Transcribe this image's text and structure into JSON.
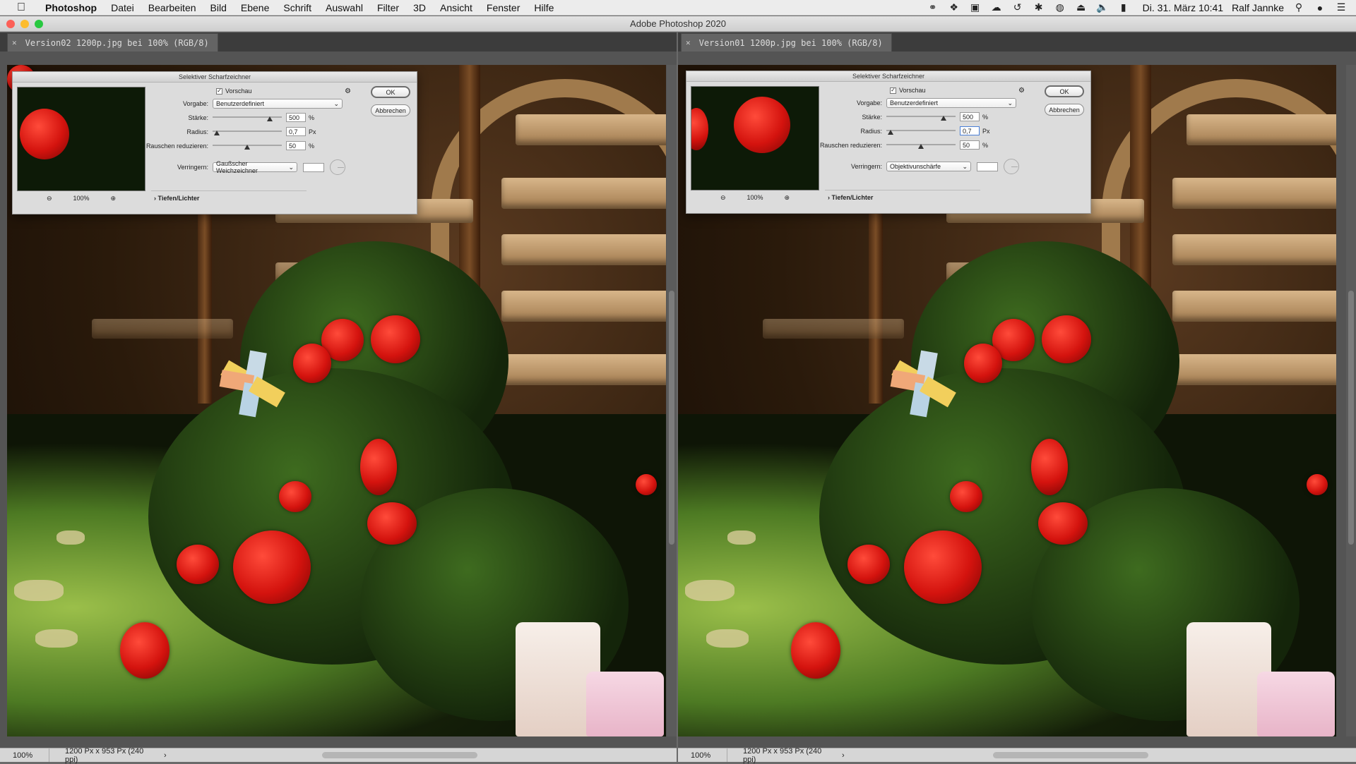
{
  "menubar": {
    "app_name": "Photoshop",
    "menus": [
      "Datei",
      "Bearbeiten",
      "Bild",
      "Ebene",
      "Schrift",
      "Auswahl",
      "Filter",
      "3D",
      "Ansicht",
      "Fenster",
      "Hilfe"
    ],
    "clock": "Di. 31. März  10:41",
    "user": "Ralf Jannke",
    "status_icons": [
      "creative-cloud-icon",
      "dropbox-icon",
      "display-icon",
      "upload-icon",
      "timemachine-icon",
      "bluetooth-icon",
      "wifi-icon",
      "eject-icon",
      "volume-icon",
      "battery-icon"
    ]
  },
  "window": {
    "title": "Adobe Photoshop 2020"
  },
  "documents": [
    {
      "tab_label": "Version02 1200p.jpg bei 100% (RGB/8)",
      "status_zoom": "100%",
      "status_info": "1200 Px x 953 Px (240 ppi)",
      "dialog": {
        "title": "Selektiver Scharfzeichner",
        "preview_label": "Vorschau",
        "preview_checked": true,
        "preset_label": "Vorgabe:",
        "preset_value": "Benutzerdefiniert",
        "amount_label": "Stärke:",
        "amount_value": "500",
        "amount_unit": "%",
        "amount_level": 0.83,
        "radius_label": "Radius:",
        "radius_value": "0,7",
        "radius_unit": "Px",
        "radius_level": 0.06,
        "noise_label": "Rauschen reduzieren:",
        "noise_value": "50",
        "noise_unit": "%",
        "noise_level": 0.5,
        "remove_label": "Verringern:",
        "remove_value": "Gaußscher Weichzeichner",
        "zoom_value": "100%",
        "ok_label": "OK",
        "cancel_label": "Abbrechen",
        "section_label": "Tiefen/Lichter"
      }
    },
    {
      "tab_label": "Version01 1200p.jpg bei 100% (RGB/8)",
      "status_zoom": "100%",
      "status_info": "1200 Px x 953 Px (240 ppi)",
      "dialog": {
        "title": "Selektiver Scharfzeichner",
        "preview_label": "Vorschau",
        "preview_checked": true,
        "preset_label": "Vorgabe:",
        "preset_value": "Benutzerdefiniert",
        "amount_label": "Stärke:",
        "amount_value": "500",
        "amount_unit": "%",
        "amount_level": 0.83,
        "radius_label": "Radius:",
        "radius_value": "0,7",
        "radius_unit": "Px",
        "radius_level": 0.06,
        "noise_label": "Rauschen reduzieren:",
        "noise_value": "50",
        "noise_unit": "%",
        "noise_level": 0.5,
        "remove_label": "Verringern:",
        "remove_value": "Objektivunschärfe",
        "zoom_value": "100%",
        "ok_label": "OK",
        "cancel_label": "Abbrechen",
        "section_label": "Tiefen/Lichter"
      }
    }
  ],
  "colors": {
    "traffic_close": "#fc5f57",
    "traffic_min": "#fdbc2e",
    "traffic_max": "#28c840"
  }
}
